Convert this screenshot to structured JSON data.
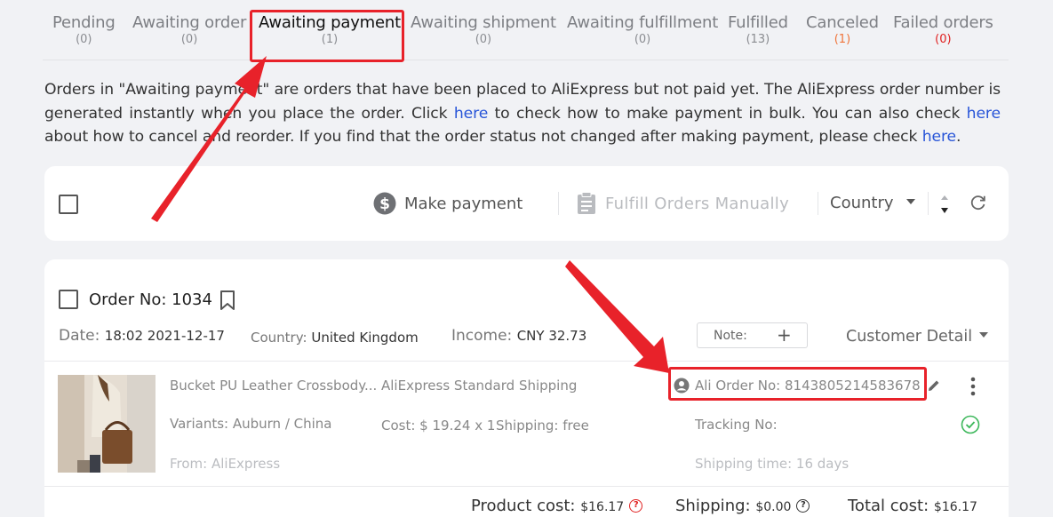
{
  "tabs": [
    {
      "label": "Pending",
      "count": "(0)"
    },
    {
      "label": "Awaiting order",
      "count": "(0)"
    },
    {
      "label": "Awaiting payment",
      "count": "(1)"
    },
    {
      "label": "Awaiting shipment",
      "count": "(0)"
    },
    {
      "label": "Awaiting fulfillment",
      "count": "(0)"
    },
    {
      "label": "Fulfilled",
      "count": "(13)"
    },
    {
      "label": "Canceled",
      "count": "(1)"
    },
    {
      "label": "Failed orders",
      "count": "(0)"
    }
  ],
  "info": {
    "p1": "Orders in \"Awaiting payment\" are orders that have been placed to AliExpress but not paid yet. The AliExpress order number is generated instantly when you place the order. Click ",
    "link1": "here",
    "p2": " to check how to make payment in bulk. You can also check ",
    "link2": "here",
    "p3": " about how to cancel and reorder. If you find that the order status not changed after making payment, please check ",
    "link3": "here",
    "p4": "."
  },
  "toolbar": {
    "make_payment": "Make payment",
    "fulfill_manually": "Fulfill Orders Manually",
    "country": "Country"
  },
  "order": {
    "order_no": "Order No: 1034",
    "date_label": "Date:",
    "date_value": "18:02 2021-12-17",
    "country_label": "Country:",
    "country_value": "United Kingdom",
    "income_label": "Income:",
    "income_value": "CNY 32.73",
    "note_label": "Note:",
    "note_add": "+",
    "customer_detail": "Customer Detail",
    "product_title": "Bucket PU Leather Crossbody...",
    "variants": "Variants: Auburn / China",
    "from": "From: AliExpress",
    "shipping_method": "AliExpress Standard Shipping",
    "cost": "Cost: $ 19.24 x 1",
    "shipping_fee": "Shipping: free",
    "ali_order_no": "Ali Order No: 8143805214583678",
    "tracking_no": "Tracking No:",
    "shipping_time": "Shipping time: 16 days",
    "product_cost_label": "Product cost:",
    "product_cost_value": "$16.17",
    "shipping_label": "Shipping:",
    "shipping_value": "$0.00",
    "total_cost_label": "Total cost:",
    "total_cost_value": "$16.17"
  },
  "colors": {
    "link": "#2855d8",
    "annotation": "#e8222a",
    "success": "#3cb75a",
    "canceled_count": "#f0743a",
    "failed_count": "#e02020"
  },
  "icons": {
    "make_payment": "dollar-circle-icon",
    "fulfill": "clipboard-icon",
    "bookmark": "bookmark-icon",
    "ali_order": "user-circle-icon",
    "edit": "pencil-icon",
    "more": "kebab-icon",
    "status": "check-circle-icon",
    "sort": "sort-icon",
    "refresh": "refresh-icon"
  }
}
